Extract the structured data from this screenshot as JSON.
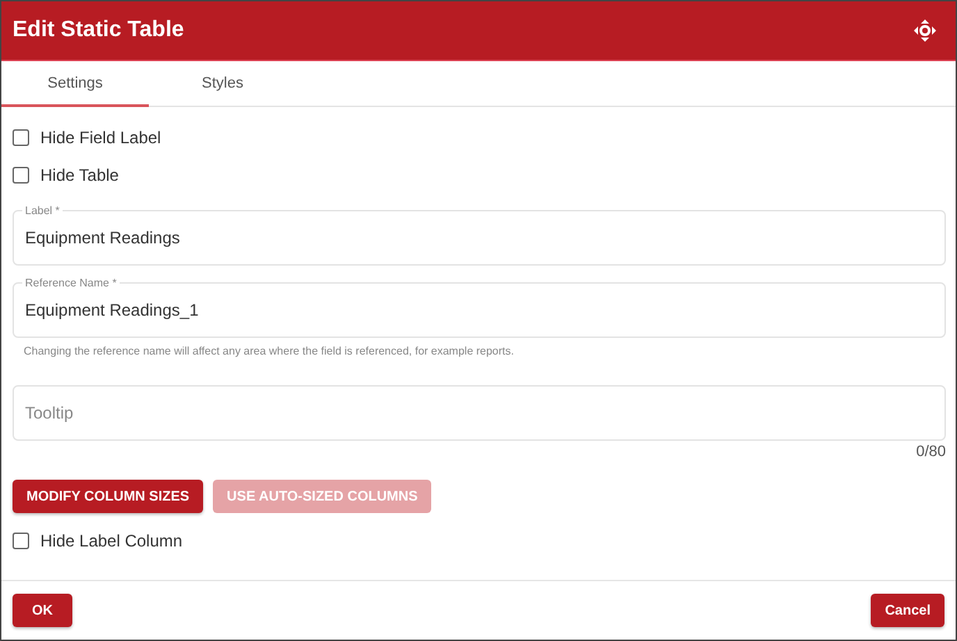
{
  "window": {
    "title": "Edit Static Table"
  },
  "tabs": [
    {
      "label": "Settings",
      "selected": true
    },
    {
      "label": "Styles",
      "selected": false
    }
  ],
  "options_top": [
    {
      "label": "Hide Field Label",
      "checked": false
    },
    {
      "label": "Hide Table",
      "checked": false
    }
  ],
  "fields": [
    {
      "label": "Label *",
      "value": "Equipment Readings"
    },
    {
      "label": "Reference Name *",
      "value": "Equipment Readings_1",
      "helper": "Changing the reference name will affect any area where the field is referenced, for example reports."
    },
    {
      "placeholder": "Tooltip",
      "counter": "0/80"
    }
  ],
  "column_buttons": [
    {
      "label": "MODIFY COLUMN SIZES",
      "disabled": false
    },
    {
      "label": "USE AUTO-SIZED COLUMNS",
      "disabled": true
    }
  ],
  "options_bottom": [
    {
      "label": "Hide Label Column",
      "checked": false
    }
  ],
  "footer": {
    "ok": "OK",
    "cancel": "Cancel"
  }
}
